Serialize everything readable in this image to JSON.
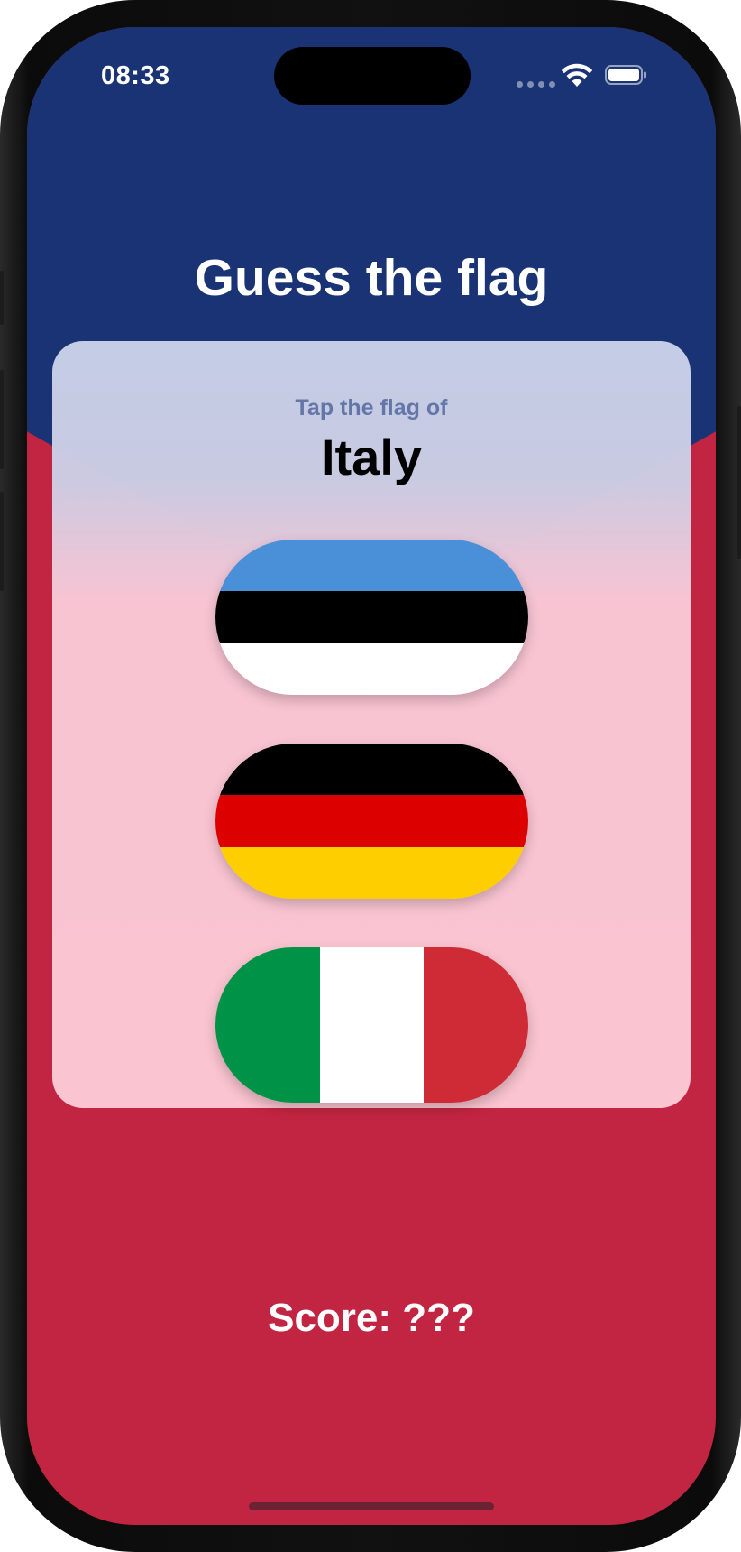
{
  "status_bar": {
    "time": "08:33",
    "icons": [
      "cellular-signal-icon",
      "wifi-icon",
      "battery-icon"
    ]
  },
  "header": {
    "title": "Guess the flag"
  },
  "card": {
    "prompt": "Tap the flag of",
    "country": "Italy",
    "options": [
      {
        "country": "Estonia",
        "stripes": "horizontal",
        "colors": [
          "#4a90d9",
          "#000000",
          "#ffffff"
        ]
      },
      {
        "country": "Germany",
        "stripes": "horizontal",
        "colors": [
          "#000000",
          "#dd0000",
          "#ffce00"
        ]
      },
      {
        "country": "Italy",
        "stripes": "vertical",
        "colors": [
          "#009246",
          "#ffffff",
          "#ce2b37"
        ]
      }
    ]
  },
  "footer": {
    "score_label": "Score: ???"
  },
  "colors": {
    "background_blue": "#1a3374",
    "background_red": "#c22541",
    "card_top": "#c4cce6",
    "card_bottom": "#fac4d0",
    "prompt_text": "#6476a8"
  }
}
